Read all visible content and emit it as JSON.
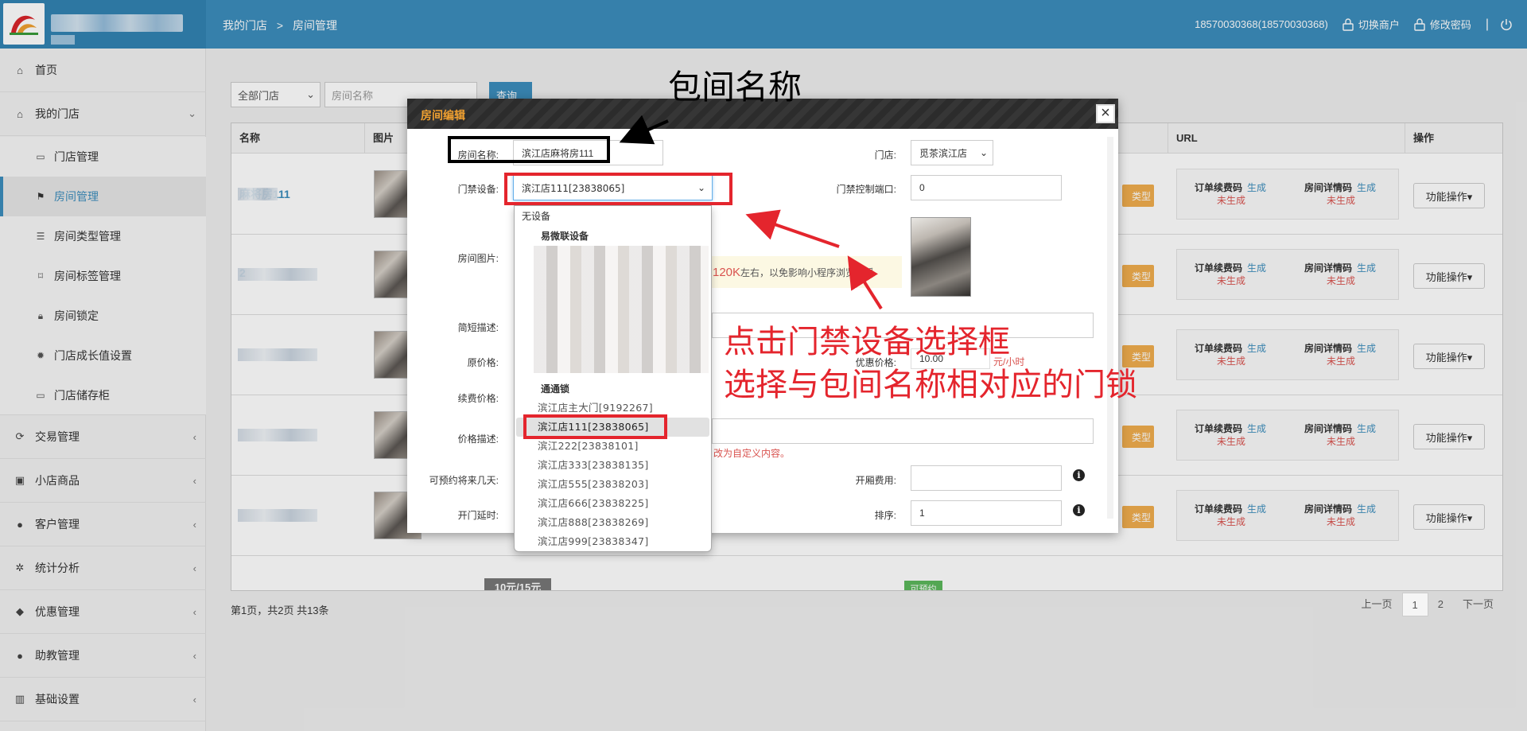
{
  "header": {
    "breadcrumb": [
      "我的门店",
      ">",
      "房间管理"
    ],
    "account": "18570030368(18570030368)",
    "switch_merchant": "切换商户",
    "change_password": "修改密码"
  },
  "sidebar": {
    "items": [
      {
        "label": "首页",
        "icon": "home-icon"
      },
      {
        "label": "我的门店",
        "icon": "home-icon"
      },
      {
        "label": "门店管理",
        "icon": "inbox-icon"
      },
      {
        "label": "房间管理",
        "icon": "flag-icon"
      },
      {
        "label": "房间类型管理",
        "icon": "list-icon"
      },
      {
        "label": "房间标签管理",
        "icon": "bookmark-icon"
      },
      {
        "label": "房间锁定",
        "icon": "lock-icon"
      },
      {
        "label": "门店成长值设置",
        "icon": "gear-icon"
      },
      {
        "label": "门店储存柜",
        "icon": "inbox-icon"
      },
      {
        "label": "交易管理",
        "icon": "refresh-icon"
      },
      {
        "label": "小店商品",
        "icon": "gift-icon"
      },
      {
        "label": "客户管理",
        "icon": "user-icon"
      },
      {
        "label": "统计分析",
        "icon": "gear-icon"
      },
      {
        "label": "优惠管理",
        "icon": "tags-icon"
      },
      {
        "label": "助教管理",
        "icon": "user-icon"
      },
      {
        "label": "基础设置",
        "icon": "barcode-icon"
      }
    ]
  },
  "filters": {
    "store_select": "全部门店",
    "room_name_placeholder": "房间名称",
    "search_button": "查询"
  },
  "table": {
    "headers": [
      "名称",
      "图片",
      "URL",
      "操作"
    ],
    "rows": [
      {
        "name": "麻将房111"
      },
      {
        "name": "2"
      },
      {
        "name": ""
      },
      {
        "name": ""
      },
      {
        "name": ""
      }
    ],
    "url_order_code": "订单续费码",
    "url_detail_code": "房间详情码",
    "generate": "生成",
    "not_generated": "未生成",
    "op_button": "功能操作▾",
    "type_button": "类型",
    "last_row_price": "10元/15元",
    "last_row_badge": "可预约"
  },
  "pagination": {
    "info": "第1页，共2页 共13条",
    "prev": "上一页",
    "pages": [
      "1",
      "2"
    ],
    "next": "下一页"
  },
  "modal": {
    "title": "房间编辑",
    "labels": {
      "room_name": "房间名称:",
      "access_device": "门禁设备:",
      "room_image": "房间图片:",
      "brief": "简短描述:",
      "original_price": "原价格:",
      "renew_price": "续费价格:",
      "price_desc": "价格描述:",
      "book_days": "可预约将来几天:",
      "door_delay": "开门延时:",
      "store": "门店:",
      "access_port": "门禁控制端口:",
      "discount_price": "优惠价格:",
      "open_fee": "开厢费用:",
      "sort": "排序:"
    },
    "values": {
      "room_name": "滨江店麻将房111",
      "access_device": "滨江店111[23838065]",
      "store": "觅茶滨江店",
      "access_port": "0",
      "discount_price": "10.00",
      "discount_unit": "元/小时",
      "sort": "1"
    },
    "image_hint_size": "120K",
    "image_hint_text": "左右，以免影响小程序浏览感受",
    "price_desc_hint": "改为自定义内容。"
  },
  "dropdown": {
    "none": "无设备",
    "group1": "易微联设备",
    "group2": "通通锁",
    "options": [
      "滨江店主大门[9192267]",
      "滨江店111[23838065]",
      "滨江222[23838101]",
      "滨江店333[23838135]",
      "滨江店555[23838203]",
      "滨江店666[23838225]",
      "滨江店888[23838269]",
      "滨江店999[23838347]"
    ],
    "selected_index": 1
  },
  "annotations": {
    "room_name_caption": "包间名称",
    "instruction_line1": "点击门禁设备选择框",
    "instruction_line2": "选择与包间名称相对应的门锁"
  },
  "colors": {
    "header_blue": "#3c8dbc",
    "annotation_red": "#e4252d",
    "modal_title": "#f0a030"
  }
}
